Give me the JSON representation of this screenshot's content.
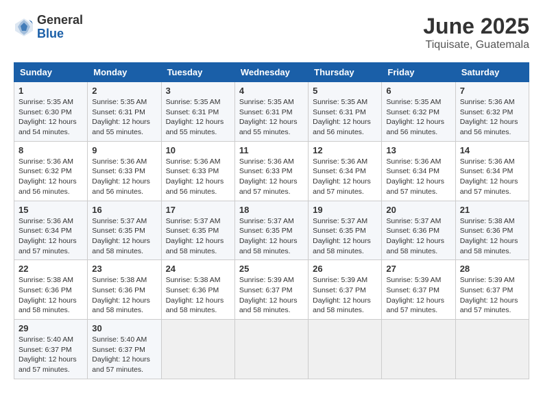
{
  "logo": {
    "general": "General",
    "blue": "Blue"
  },
  "title": "June 2025",
  "subtitle": "Tiquisate, Guatemala",
  "weekdays": [
    "Sunday",
    "Monday",
    "Tuesday",
    "Wednesday",
    "Thursday",
    "Friday",
    "Saturday"
  ],
  "weeks": [
    [
      {
        "day": "1",
        "sunrise": "5:35 AM",
        "sunset": "6:30 PM",
        "daylight": "12 hours and 54 minutes."
      },
      {
        "day": "2",
        "sunrise": "5:35 AM",
        "sunset": "6:31 PM",
        "daylight": "12 hours and 55 minutes."
      },
      {
        "day": "3",
        "sunrise": "5:35 AM",
        "sunset": "6:31 PM",
        "daylight": "12 hours and 55 minutes."
      },
      {
        "day": "4",
        "sunrise": "5:35 AM",
        "sunset": "6:31 PM",
        "daylight": "12 hours and 55 minutes."
      },
      {
        "day": "5",
        "sunrise": "5:35 AM",
        "sunset": "6:31 PM",
        "daylight": "12 hours and 56 minutes."
      },
      {
        "day": "6",
        "sunrise": "5:35 AM",
        "sunset": "6:32 PM",
        "daylight": "12 hours and 56 minutes."
      },
      {
        "day": "7",
        "sunrise": "5:36 AM",
        "sunset": "6:32 PM",
        "daylight": "12 hours and 56 minutes."
      }
    ],
    [
      {
        "day": "8",
        "sunrise": "5:36 AM",
        "sunset": "6:32 PM",
        "daylight": "12 hours and 56 minutes."
      },
      {
        "day": "9",
        "sunrise": "5:36 AM",
        "sunset": "6:33 PM",
        "daylight": "12 hours and 56 minutes."
      },
      {
        "day": "10",
        "sunrise": "5:36 AM",
        "sunset": "6:33 PM",
        "daylight": "12 hours and 56 minutes."
      },
      {
        "day": "11",
        "sunrise": "5:36 AM",
        "sunset": "6:33 PM",
        "daylight": "12 hours and 57 minutes."
      },
      {
        "day": "12",
        "sunrise": "5:36 AM",
        "sunset": "6:34 PM",
        "daylight": "12 hours and 57 minutes."
      },
      {
        "day": "13",
        "sunrise": "5:36 AM",
        "sunset": "6:34 PM",
        "daylight": "12 hours and 57 minutes."
      },
      {
        "day": "14",
        "sunrise": "5:36 AM",
        "sunset": "6:34 PM",
        "daylight": "12 hours and 57 minutes."
      }
    ],
    [
      {
        "day": "15",
        "sunrise": "5:36 AM",
        "sunset": "6:34 PM",
        "daylight": "12 hours and 57 minutes."
      },
      {
        "day": "16",
        "sunrise": "5:37 AM",
        "sunset": "6:35 PM",
        "daylight": "12 hours and 58 minutes."
      },
      {
        "day": "17",
        "sunrise": "5:37 AM",
        "sunset": "6:35 PM",
        "daylight": "12 hours and 58 minutes."
      },
      {
        "day": "18",
        "sunrise": "5:37 AM",
        "sunset": "6:35 PM",
        "daylight": "12 hours and 58 minutes."
      },
      {
        "day": "19",
        "sunrise": "5:37 AM",
        "sunset": "6:35 PM",
        "daylight": "12 hours and 58 minutes."
      },
      {
        "day": "20",
        "sunrise": "5:37 AM",
        "sunset": "6:36 PM",
        "daylight": "12 hours and 58 minutes."
      },
      {
        "day": "21",
        "sunrise": "5:38 AM",
        "sunset": "6:36 PM",
        "daylight": "12 hours and 58 minutes."
      }
    ],
    [
      {
        "day": "22",
        "sunrise": "5:38 AM",
        "sunset": "6:36 PM",
        "daylight": "12 hours and 58 minutes."
      },
      {
        "day": "23",
        "sunrise": "5:38 AM",
        "sunset": "6:36 PM",
        "daylight": "12 hours and 58 minutes."
      },
      {
        "day": "24",
        "sunrise": "5:38 AM",
        "sunset": "6:36 PM",
        "daylight": "12 hours and 58 minutes."
      },
      {
        "day": "25",
        "sunrise": "5:39 AM",
        "sunset": "6:37 PM",
        "daylight": "12 hours and 58 minutes."
      },
      {
        "day": "26",
        "sunrise": "5:39 AM",
        "sunset": "6:37 PM",
        "daylight": "12 hours and 58 minutes."
      },
      {
        "day": "27",
        "sunrise": "5:39 AM",
        "sunset": "6:37 PM",
        "daylight": "12 hours and 57 minutes."
      },
      {
        "day": "28",
        "sunrise": "5:39 AM",
        "sunset": "6:37 PM",
        "daylight": "12 hours and 57 minutes."
      }
    ],
    [
      {
        "day": "29",
        "sunrise": "5:40 AM",
        "sunset": "6:37 PM",
        "daylight": "12 hours and 57 minutes."
      },
      {
        "day": "30",
        "sunrise": "5:40 AM",
        "sunset": "6:37 PM",
        "daylight": "12 hours and 57 minutes."
      },
      null,
      null,
      null,
      null,
      null
    ]
  ],
  "labels": {
    "sunrise": "Sunrise: ",
    "sunset": "Sunset: ",
    "daylight": "Daylight: "
  }
}
